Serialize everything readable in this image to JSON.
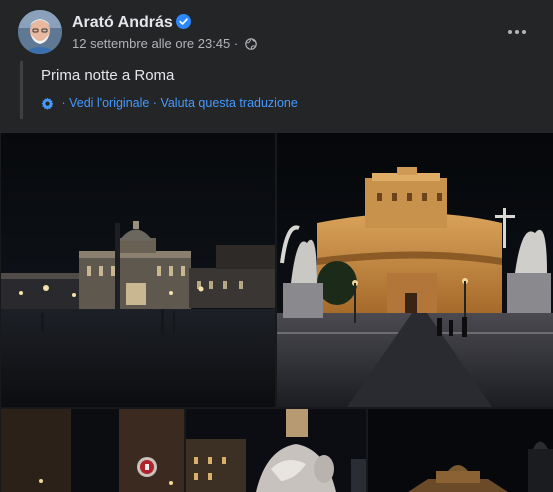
{
  "post": {
    "author": "Arató András",
    "timestamp": "12 settembre alle ore 23:45",
    "separator": " · ",
    "text": "Prima notte a Roma",
    "translation_separator_1": " · ",
    "see_original": "Vedi l'originale",
    "translation_separator_2": " · ",
    "rate_translation": "Valuta questa traduzione"
  },
  "icons": {
    "verified": "verified-badge-icon",
    "privacy": "globe-icon",
    "more": "more-options-icon",
    "translate": "gear-icon"
  },
  "colors": {
    "background": "#18191a",
    "card": "#242526",
    "primary_text": "#e4e6eb",
    "secondary_text": "#b0b3b8",
    "link": "#4599ff",
    "verified": "#2d88ff"
  },
  "photos": [
    {
      "name": "photo-st-peters-square"
    },
    {
      "name": "photo-castel-sant-angelo"
    },
    {
      "name": "photo-street-night"
    },
    {
      "name": "photo-fountain-statue"
    },
    {
      "name": "photo-dark-building"
    }
  ]
}
